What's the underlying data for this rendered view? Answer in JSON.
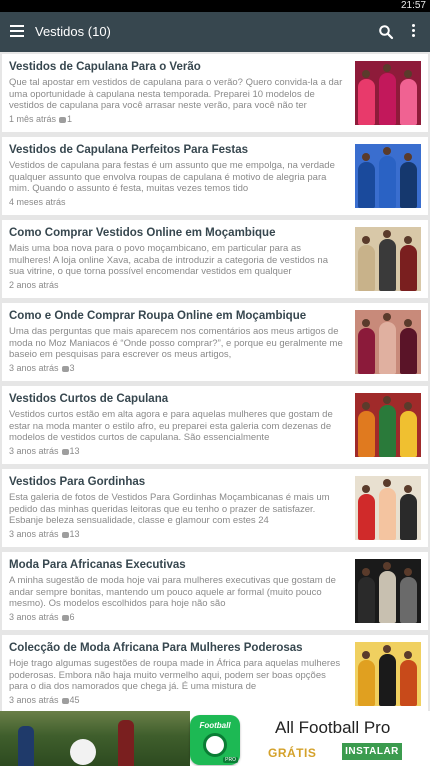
{
  "status_bar": {
    "time": "21:57"
  },
  "app_bar": {
    "title": "Vestidos (10)",
    "menu_icon": "hamburger-menu-icon",
    "search_icon": "search-icon",
    "overflow_icon": "more-vert-icon"
  },
  "posts": [
    {
      "title": "Vestidos de Capulana Para o Verão",
      "excerpt": "Que tal apostar em vestidos de capulana para o verão? Quero convida-la a dar uma oportunidade à capulana nesta temporada. Preparei 10 modelos de vestidos de capulana para você arrasar neste verão, para você não ter",
      "date": "1 mês atrás",
      "comments": "1"
    },
    {
      "title": "Vestidos de Capulana Perfeitos Para Festas",
      "excerpt": "Vestidos de capulana para festas é um assunto que me empolga, na verdade qualquer assunto que envolva roupas de capulana é motivo de alegria para mim. Quando o assunto é festa, muitas vezes temos tido",
      "date": "4 meses atrás",
      "comments": ""
    },
    {
      "title": "Como Comprar Vestidos Online em Moçambique",
      "excerpt": "Mais uma boa nova para o povo moçambicano, em particular para as mulheres! A loja online Xava, acaba de introduzir a categoria de vestidos na sua vitrine, o que torna possível encomendar vestidos em qualquer",
      "date": "2 anos atrás",
      "comments": ""
    },
    {
      "title": "Como e Onde Comprar Roupa Online em Moçambique",
      "excerpt": "Uma das perguntas que mais aparecem nos comentários aos meus artigos de moda no Moz Maniacos é “Onde posso comprar?”, e porque eu geralmente me baseio em pesquisas para escrever os meus artigos,",
      "date": "3 anos atrás",
      "comments": "3"
    },
    {
      "title": "Vestidos Curtos de Capulana",
      "excerpt": "Vestidos curtos estão em alta agora e para aquelas mulheres que gostam de estar na moda manter o estilo afro, eu preparei esta galeria com dezenas de modelos de vestidos curtos de capulana. São essencialmente",
      "date": "3 anos atrás",
      "comments": "13"
    },
    {
      "title": "Vestidos Para Gordinhas",
      "excerpt": "Esta galeria de fotos de  Vestidos Para Gordinhas Moçambicanas é mais um pedido das minhas queridas leitoras que eu tenho o prazer de satisfazer. Esbanje beleza sensualidade, classe e glamour com estes 24",
      "date": "3 anos atrás",
      "comments": "13"
    },
    {
      "title": "Moda Para Africanas Executivas",
      "excerpt": "A minha sugestão de moda hoje vai para mulheres executivas que gostam de andar sempre bonitas, mantendo um pouco aquele ar formal (muito pouco mesmo). Os modelos escolhidos para hoje não são",
      "date": "3 anos atrás",
      "comments": "6"
    },
    {
      "title": "Colecção de Moda Africana Para Mulheres Poderosas",
      "excerpt": "Hoje trago algumas sugestões de roupa made in África para aquelas mulheres poderosas. Embora não haja muito vermelho aqui, podem ser boas opções para o dia dos namorados que chega já. É uma mistura de",
      "date": "3 anos atrás",
      "comments": "45"
    }
  ],
  "thumb_palettes": [
    [
      "#e83a6b",
      "#c2185b",
      "#f06292",
      "#8e1b3a"
    ],
    [
      "#1a4a9c",
      "#2a62c4",
      "#15386e",
      "#3a6ecf"
    ],
    [
      "#c8b28a",
      "#3a3a3a",
      "#7a1f1f",
      "#d8c8a8"
    ],
    [
      "#8b1a3a",
      "#e0b0a0",
      "#5a1428",
      "#c88a7a"
    ],
    [
      "#e07a1f",
      "#2a7a3a",
      "#f0c030",
      "#a02a2a"
    ],
    [
      "#d02a2a",
      "#f4c4a0",
      "#2a2a2a",
      "#e8e0d0"
    ],
    [
      "#2a2a2a",
      "#c8c0b0",
      "#6a6a6a",
      "#1a1a1a"
    ],
    [
      "#e0a020",
      "#1a1a1a",
      "#c84a1a",
      "#f0d060"
    ]
  ],
  "ad": {
    "app_name": "All Football Pro",
    "price": "GRÁTIS",
    "install_label": "INSTALAR",
    "logo_word": "Football",
    "logo_badge": "PRO",
    "logo_icon": "soccer-ball-icon"
  }
}
